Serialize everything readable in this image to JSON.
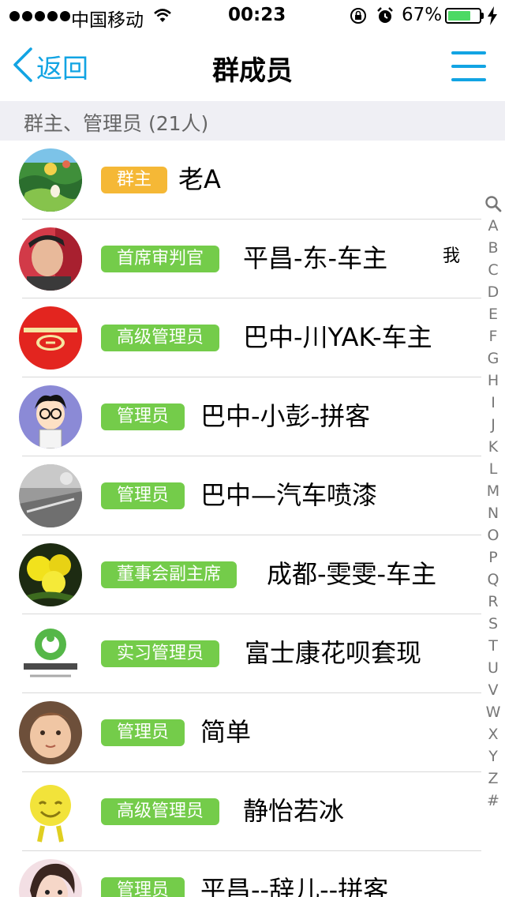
{
  "status_bar": {
    "carrier": "中国移动",
    "time": "00:23",
    "battery": "67%",
    "battery_level": 0.67,
    "icons": [
      "signal-dots-icon",
      "wifi-icon",
      "rotation-lock-icon",
      "alarm-icon",
      "battery-icon",
      "charging-icon"
    ]
  },
  "nav": {
    "back_label": "返回",
    "title": "群成员",
    "back_icon": "chevron-left-icon",
    "menu_icon": "menu-icon"
  },
  "section": {
    "title": "群主、管理员 (21人)"
  },
  "colors": {
    "accent": "#12a4e3",
    "owner_badge": "#f5b836",
    "admin_badge": "#74cc4a",
    "section_bg": "#efeff4"
  },
  "members": [
    {
      "role": "群主",
      "name": "老A",
      "badge_color": "#f5b836",
      "avatar": "landscape"
    },
    {
      "role": "首席审判官",
      "name": "平昌-东-车主",
      "badge_color": "#74cc4a",
      "avatar": "person",
      "self_tag": "我"
    },
    {
      "role": "高级管理员",
      "name": "巴中-川YAK-车主",
      "badge_color": "#74cc4a",
      "avatar": "red-logo"
    },
    {
      "role": "管理员",
      "name": "巴中-小彭-拼客",
      "badge_color": "#74cc4a",
      "avatar": "cartoon"
    },
    {
      "role": "管理员",
      "name": "巴中—汽车喷漆",
      "badge_color": "#74cc4a",
      "avatar": "gray-photo"
    },
    {
      "role": "董事会副主席",
      "name": "成都-雯雯-车主",
      "badge_color": "#74cc4a",
      "avatar": "yellow-flower"
    },
    {
      "role": "实习管理员",
      "name": "富士康花呗套现",
      "badge_color": "#74cc4a",
      "avatar": "green-logo"
    },
    {
      "role": "管理员",
      "name": "简单",
      "badge_color": "#74cc4a",
      "avatar": "child"
    },
    {
      "role": "高级管理员",
      "name": "静怡若冰",
      "badge_color": "#74cc4a",
      "avatar": "yellow-smiley"
    },
    {
      "role": "管理员",
      "name": "平昌--辞儿--拼客",
      "badge_color": "#74cc4a",
      "avatar": "girl"
    }
  ],
  "index_bar": [
    "A",
    "B",
    "C",
    "D",
    "E",
    "F",
    "G",
    "H",
    "I",
    "J",
    "K",
    "L",
    "M",
    "N",
    "O",
    "P",
    "Q",
    "R",
    "S",
    "T",
    "U",
    "V",
    "W",
    "X",
    "Y",
    "Z",
    "#"
  ]
}
